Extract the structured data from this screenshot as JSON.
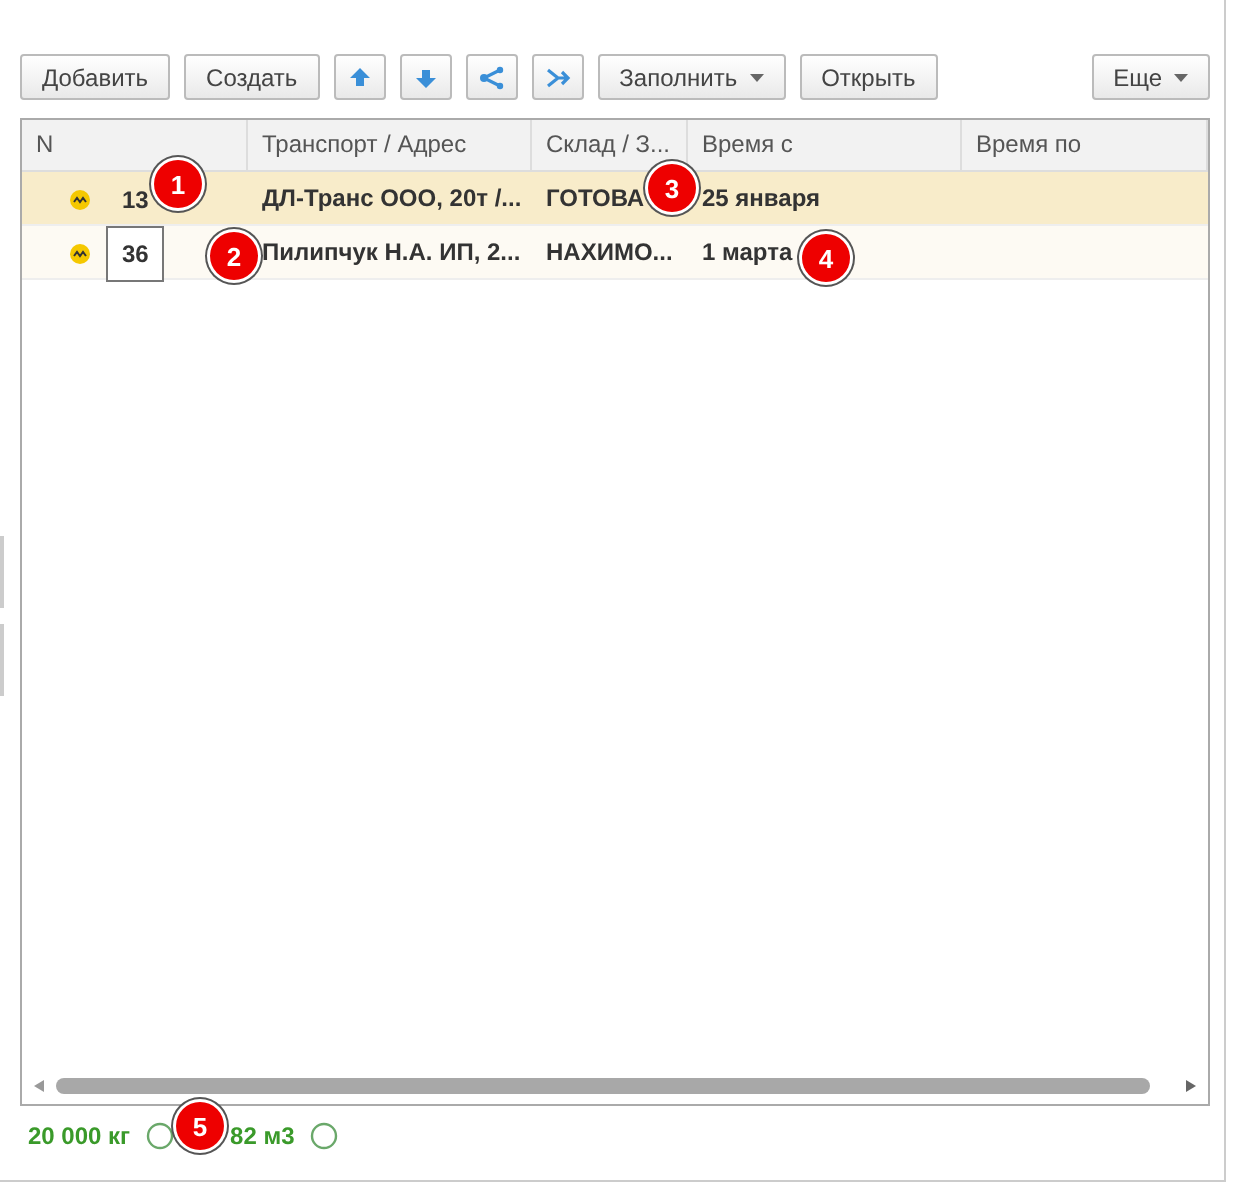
{
  "toolbar": {
    "buttons": [
      {
        "kind": "text",
        "label": "Добавить"
      },
      {
        "kind": "text",
        "label": "Создать"
      },
      {
        "kind": "icon"
      },
      {
        "kind": "icon"
      },
      {
        "kind": "icon"
      },
      {
        "kind": "icon"
      },
      {
        "kind": "menu",
        "label": "Заполнить"
      },
      {
        "kind": "text",
        "label": "Открыть"
      }
    ],
    "more": {
      "label": "Еще"
    }
  },
  "table": {
    "columns": [
      "N",
      "Транспорт / Адрес",
      "Склад / З...",
      "Время с",
      "Время по"
    ],
    "rows": [
      {
        "selected": true,
        "focused": false,
        "cells": [
          "13",
          "ДЛ-Транс ООО, 20т /...",
          "ГОТОВА",
          "25 января",
          ""
        ]
      },
      {
        "selected": false,
        "focused": true,
        "cells": [
          "36",
          "Пилипчук Н.А. ИП, 2...",
          "НАХИМО...",
          "1 марта",
          ""
        ]
      }
    ]
  },
  "footer": [
    {
      "text": "20 000 кг"
    },
    {
      "text": "82 м3"
    }
  ],
  "callouts": [
    {
      "label": "1"
    },
    {
      "label": "2"
    },
    {
      "label": "3"
    },
    {
      "label": "4"
    },
    {
      "label": "5"
    }
  ]
}
